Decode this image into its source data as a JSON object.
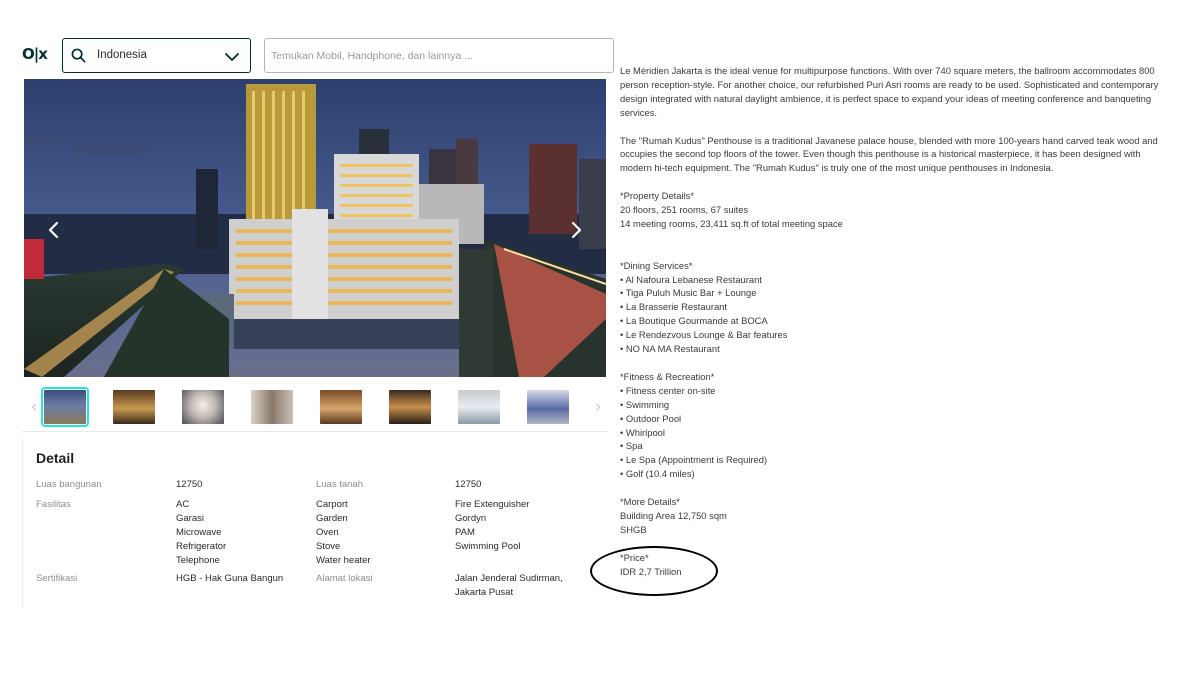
{
  "header": {
    "logo": "O|x",
    "location_value": "Indonesia",
    "search_placeholder": "Temukan Mobil, Handphone, dan lainnya ..."
  },
  "gallery": {
    "thumbnail_count": 8,
    "selected_index": 0
  },
  "detail": {
    "heading": "Detail",
    "luas_bangunan_label": "Luas bangunan",
    "luas_bangunan_value": "12750",
    "luas_tanah_label": "Luas tanah",
    "luas_tanah_value": "12750",
    "fasilitas_label": "Fasilitas",
    "fasilitas_col1": [
      "AC",
      "Garasi",
      "Microwave",
      "Refrigerator",
      "Telephone"
    ],
    "fasilitas_col2": [
      "Carport",
      "Garden",
      "Oven",
      "Stove",
      "Water heater"
    ],
    "fasilitas_col3": [
      "Fire Extenguisher",
      "Gordyn",
      "PAM",
      "Swimming Pool"
    ],
    "sertifikasi_label": "Sertifikasi",
    "sertifikasi_value": "HGB - Hak Guna Bangun",
    "alamat_label": "Alamat lokasi",
    "alamat_value_1": "Jalan Jenderal Sudirman,",
    "alamat_value_2": "Jakarta Pusat"
  },
  "description": {
    "intro": [
      "Le Méridien Jakarta is the ideal venue for multipurpose functions. With over 740 square meters, the ballroom accommodates 800",
      "person reception-style. For another choice, our refurbished Puri Asri rooms are ready to be used. Sophisticated and contemporary",
      "design integrated with natural daylight ambience, it is perfect space to expand your ideas of meeting conference and banqueting",
      "services."
    ],
    "penthouse": [
      "The \"Rumah Kudus\" Penthouse is a traditional Javanese palace house, blended with more 100-years hand carved teak wood and",
      "occupies the second top floors of the tower. Even though this penthouse is a historical masterpiece, it has been designed with",
      "modern hi-tech equipment. The \"Rumah Kudus\" is truly one of the most unique penthouses in Indonesia."
    ],
    "property_heading": "*Property Details*",
    "property_lines": [
      "20 floors, 251 rooms, 67 suites",
      "14 meeting rooms, 23,411 sq.ft of total meeting space"
    ],
    "dining_heading": "*Dining Services*",
    "dining_lines": [
      "• Al Nafoura Lebanese Restaurant",
      "• Tiga Puluh Music Bar + Lounge",
      "• La Brasserie Restaurant",
      "• La Boutique Gourmande at BOCA",
      "• Le Rendezvous Lounge & Bar features",
      "• NO NA MA Restaurant"
    ],
    "fitness_heading": "*Fitness & Recreation*",
    "fitness_lines": [
      "• Fitness center on-site",
      "• Swimming",
      "• Outdoor Pool",
      "• Whirlpool",
      "• Spa",
      "• Le Spa (Appointment is Required)",
      "• Golf (10.4 miles)"
    ],
    "more_heading": "*More Details*",
    "more_lines": [
      "Building Area 12,750 sqm",
      "SHGB"
    ],
    "price_heading": "*Price*",
    "price_value": "IDR 2,7 Trillion"
  },
  "colors": {
    "brand_dark": "#002f34",
    "thumb_selected": "#23e5db",
    "annotation": "#000000"
  }
}
